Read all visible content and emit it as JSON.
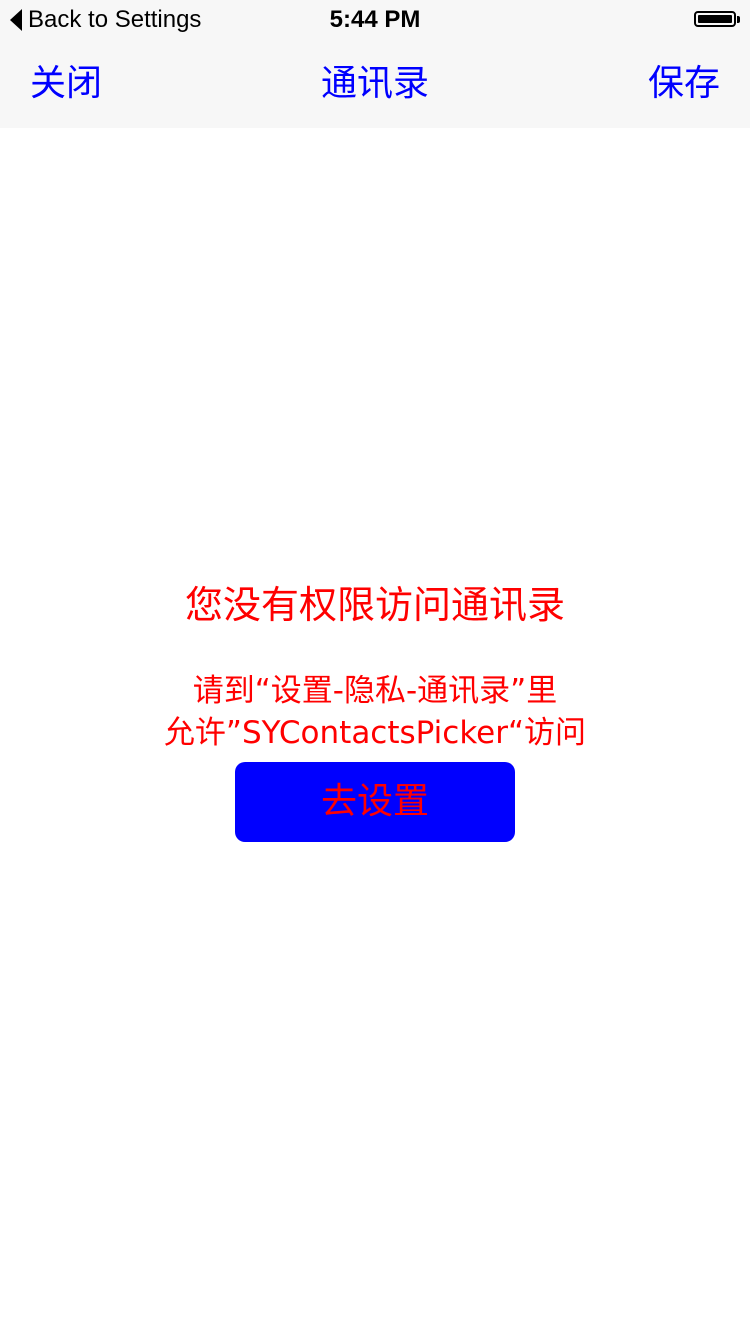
{
  "status_bar": {
    "back_label": "Back to Settings",
    "time": "5:44 PM",
    "battery_icon": "battery-full-icon"
  },
  "nav_bar": {
    "left_label": "关闭",
    "title": "通讯录",
    "right_label": "保存"
  },
  "content": {
    "title": "您没有权限访问通讯录",
    "hint_line1": "请到“设置-隐私-通讯录”里",
    "hint_line2": "允许”SYContactsPicker“访问",
    "button_label": "去设置"
  },
  "colors": {
    "accent": "#0000ff",
    "warning_text": "#ff0000",
    "bar_background": "#f7f7f7"
  }
}
